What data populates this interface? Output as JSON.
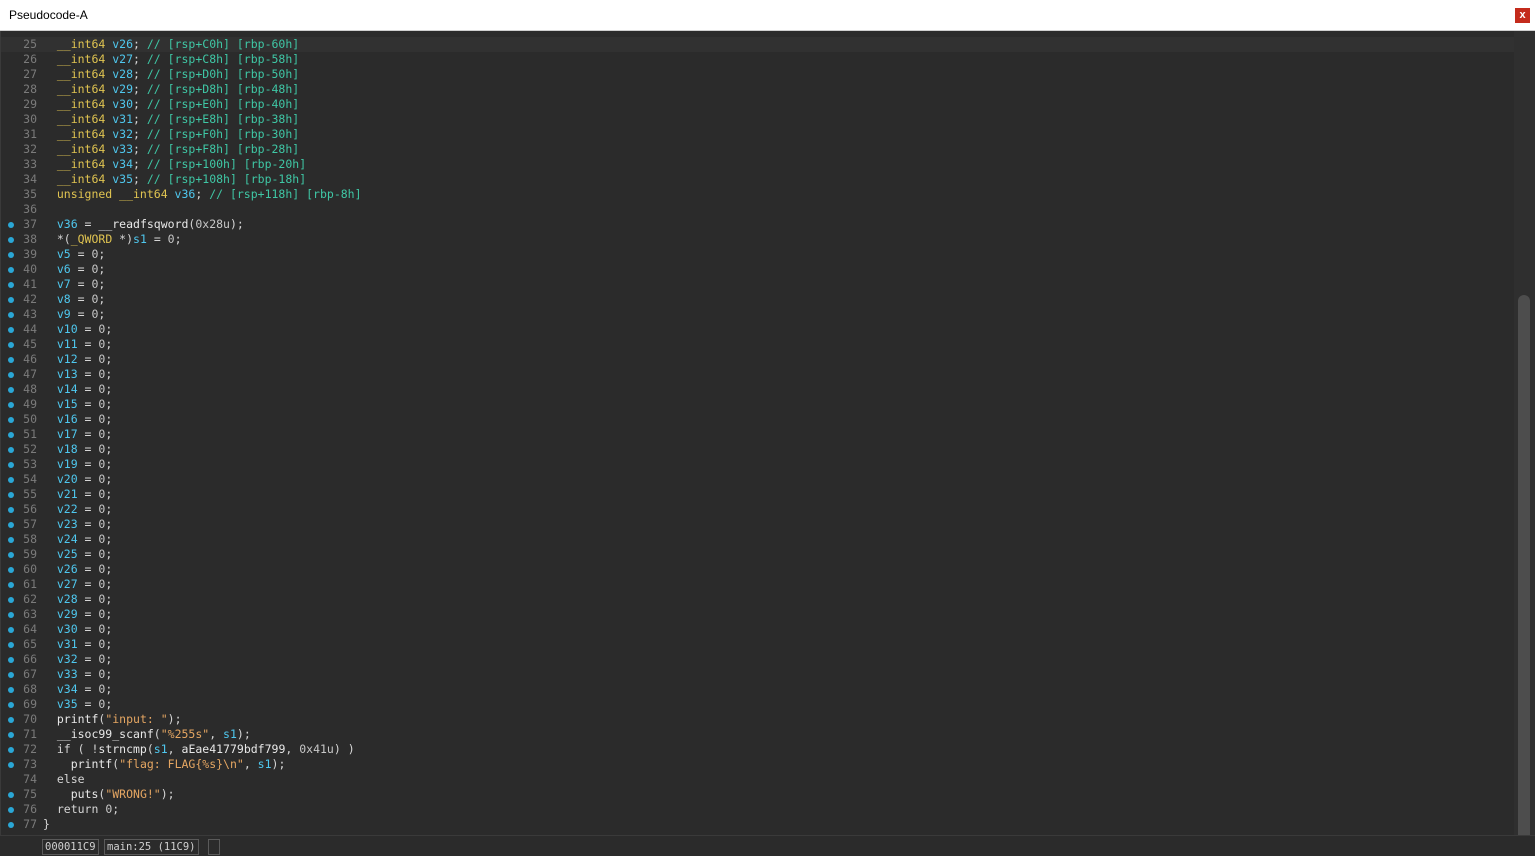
{
  "window": {
    "title": "Pseudocode-A",
    "close_label": "x"
  },
  "code_lines": [
    {
      "n": "25",
      "bp": false,
      "cur": true,
      "t": [
        [
          "kw",
          "  __int64"
        ],
        [
          "var",
          " v26"
        ],
        [
          "op",
          ";"
        ],
        [
          "cm",
          " // [rsp+C0h] [rbp-60h]"
        ]
      ]
    },
    {
      "n": "26",
      "bp": false,
      "t": [
        [
          "kw",
          "  __int64"
        ],
        [
          "var",
          " v27"
        ],
        [
          "op",
          ";"
        ],
        [
          "cm",
          " // [rsp+C8h] [rbp-58h]"
        ]
      ]
    },
    {
      "n": "27",
      "bp": false,
      "t": [
        [
          "kw",
          "  __int64"
        ],
        [
          "var",
          " v28"
        ],
        [
          "op",
          ";"
        ],
        [
          "cm",
          " // [rsp+D0h] [rbp-50h]"
        ]
      ]
    },
    {
      "n": "28",
      "bp": false,
      "t": [
        [
          "kw",
          "  __int64"
        ],
        [
          "var",
          " v29"
        ],
        [
          "op",
          ";"
        ],
        [
          "cm",
          " // [rsp+D8h] [rbp-48h]"
        ]
      ]
    },
    {
      "n": "29",
      "bp": false,
      "t": [
        [
          "kw",
          "  __int64"
        ],
        [
          "var",
          " v30"
        ],
        [
          "op",
          ";"
        ],
        [
          "cm",
          " // [rsp+E0h] [rbp-40h]"
        ]
      ]
    },
    {
      "n": "30",
      "bp": false,
      "t": [
        [
          "kw",
          "  __int64"
        ],
        [
          "var",
          " v31"
        ],
        [
          "op",
          ";"
        ],
        [
          "cm",
          " // [rsp+E8h] [rbp-38h]"
        ]
      ]
    },
    {
      "n": "31",
      "bp": false,
      "t": [
        [
          "kw",
          "  __int64"
        ],
        [
          "var",
          " v32"
        ],
        [
          "op",
          ";"
        ],
        [
          "cm",
          " // [rsp+F0h] [rbp-30h]"
        ]
      ]
    },
    {
      "n": "32",
      "bp": false,
      "t": [
        [
          "kw",
          "  __int64"
        ],
        [
          "var",
          " v33"
        ],
        [
          "op",
          ";"
        ],
        [
          "cm",
          " // [rsp+F8h] [rbp-28h]"
        ]
      ]
    },
    {
      "n": "33",
      "bp": false,
      "t": [
        [
          "kw",
          "  __int64"
        ],
        [
          "var",
          " v34"
        ],
        [
          "op",
          ";"
        ],
        [
          "cm",
          " // [rsp+100h] [rbp-20h]"
        ]
      ]
    },
    {
      "n": "34",
      "bp": false,
      "t": [
        [
          "kw",
          "  __int64"
        ],
        [
          "var",
          " v35"
        ],
        [
          "op",
          ";"
        ],
        [
          "cm",
          " // [rsp+108h] [rbp-18h]"
        ]
      ]
    },
    {
      "n": "35",
      "bp": false,
      "t": [
        [
          "kw",
          "  unsigned __int64"
        ],
        [
          "var",
          " v36"
        ],
        [
          "op",
          ";"
        ],
        [
          "cm",
          " // [rsp+118h] [rbp-8h]"
        ]
      ]
    },
    {
      "n": "36",
      "bp": false,
      "t": []
    },
    {
      "n": "37",
      "bp": true,
      "t": [
        [
          "var",
          "  v36"
        ],
        [
          "op",
          " = "
        ],
        [
          "fn",
          "__readfsqword"
        ],
        [
          "op",
          "("
        ],
        [
          "num",
          "0x28u"
        ],
        [
          "op",
          ");"
        ]
      ]
    },
    {
      "n": "38",
      "bp": true,
      "t": [
        [
          "op",
          "  *("
        ],
        [
          "kw",
          "_QWORD"
        ],
        [
          "op",
          " *)"
        ],
        [
          "var",
          "s1"
        ],
        [
          "op",
          " = "
        ],
        [
          "num",
          "0"
        ],
        [
          "op",
          ";"
        ]
      ]
    },
    {
      "n": "39",
      "bp": true,
      "t": [
        [
          "var",
          "  v5"
        ],
        [
          "op",
          " = "
        ],
        [
          "num",
          "0"
        ],
        [
          "op",
          ";"
        ]
      ]
    },
    {
      "n": "40",
      "bp": true,
      "t": [
        [
          "var",
          "  v6"
        ],
        [
          "op",
          " = "
        ],
        [
          "num",
          "0"
        ],
        [
          "op",
          ";"
        ]
      ]
    },
    {
      "n": "41",
      "bp": true,
      "t": [
        [
          "var",
          "  v7"
        ],
        [
          "op",
          " = "
        ],
        [
          "num",
          "0"
        ],
        [
          "op",
          ";"
        ]
      ]
    },
    {
      "n": "42",
      "bp": true,
      "t": [
        [
          "var",
          "  v8"
        ],
        [
          "op",
          " = "
        ],
        [
          "num",
          "0"
        ],
        [
          "op",
          ";"
        ]
      ]
    },
    {
      "n": "43",
      "bp": true,
      "t": [
        [
          "var",
          "  v9"
        ],
        [
          "op",
          " = "
        ],
        [
          "num",
          "0"
        ],
        [
          "op",
          ";"
        ]
      ]
    },
    {
      "n": "44",
      "bp": true,
      "t": [
        [
          "var",
          "  v10"
        ],
        [
          "op",
          " = "
        ],
        [
          "num",
          "0"
        ],
        [
          "op",
          ";"
        ]
      ]
    },
    {
      "n": "45",
      "bp": true,
      "t": [
        [
          "var",
          "  v11"
        ],
        [
          "op",
          " = "
        ],
        [
          "num",
          "0"
        ],
        [
          "op",
          ";"
        ]
      ]
    },
    {
      "n": "46",
      "bp": true,
      "t": [
        [
          "var",
          "  v12"
        ],
        [
          "op",
          " = "
        ],
        [
          "num",
          "0"
        ],
        [
          "op",
          ";"
        ]
      ]
    },
    {
      "n": "47",
      "bp": true,
      "t": [
        [
          "var",
          "  v13"
        ],
        [
          "op",
          " = "
        ],
        [
          "num",
          "0"
        ],
        [
          "op",
          ";"
        ]
      ]
    },
    {
      "n": "48",
      "bp": true,
      "t": [
        [
          "var",
          "  v14"
        ],
        [
          "op",
          " = "
        ],
        [
          "num",
          "0"
        ],
        [
          "op",
          ";"
        ]
      ]
    },
    {
      "n": "49",
      "bp": true,
      "t": [
        [
          "var",
          "  v15"
        ],
        [
          "op",
          " = "
        ],
        [
          "num",
          "0"
        ],
        [
          "op",
          ";"
        ]
      ]
    },
    {
      "n": "50",
      "bp": true,
      "t": [
        [
          "var",
          "  v16"
        ],
        [
          "op",
          " = "
        ],
        [
          "num",
          "0"
        ],
        [
          "op",
          ";"
        ]
      ]
    },
    {
      "n": "51",
      "bp": true,
      "t": [
        [
          "var",
          "  v17"
        ],
        [
          "op",
          " = "
        ],
        [
          "num",
          "0"
        ],
        [
          "op",
          ";"
        ]
      ]
    },
    {
      "n": "52",
      "bp": true,
      "t": [
        [
          "var",
          "  v18"
        ],
        [
          "op",
          " = "
        ],
        [
          "num",
          "0"
        ],
        [
          "op",
          ";"
        ]
      ]
    },
    {
      "n": "53",
      "bp": true,
      "t": [
        [
          "var",
          "  v19"
        ],
        [
          "op",
          " = "
        ],
        [
          "num",
          "0"
        ],
        [
          "op",
          ";"
        ]
      ]
    },
    {
      "n": "54",
      "bp": true,
      "t": [
        [
          "var",
          "  v20"
        ],
        [
          "op",
          " = "
        ],
        [
          "num",
          "0"
        ],
        [
          "op",
          ";"
        ]
      ]
    },
    {
      "n": "55",
      "bp": true,
      "t": [
        [
          "var",
          "  v21"
        ],
        [
          "op",
          " = "
        ],
        [
          "num",
          "0"
        ],
        [
          "op",
          ";"
        ]
      ]
    },
    {
      "n": "56",
      "bp": true,
      "t": [
        [
          "var",
          "  v22"
        ],
        [
          "op",
          " = "
        ],
        [
          "num",
          "0"
        ],
        [
          "op",
          ";"
        ]
      ]
    },
    {
      "n": "57",
      "bp": true,
      "t": [
        [
          "var",
          "  v23"
        ],
        [
          "op",
          " = "
        ],
        [
          "num",
          "0"
        ],
        [
          "op",
          ";"
        ]
      ]
    },
    {
      "n": "58",
      "bp": true,
      "t": [
        [
          "var",
          "  v24"
        ],
        [
          "op",
          " = "
        ],
        [
          "num",
          "0"
        ],
        [
          "op",
          ";"
        ]
      ]
    },
    {
      "n": "59",
      "bp": true,
      "t": [
        [
          "var",
          "  v25"
        ],
        [
          "op",
          " = "
        ],
        [
          "num",
          "0"
        ],
        [
          "op",
          ";"
        ]
      ]
    },
    {
      "n": "60",
      "bp": true,
      "t": [
        [
          "var",
          "  v26"
        ],
        [
          "op",
          " = "
        ],
        [
          "num",
          "0"
        ],
        [
          "op",
          ";"
        ]
      ]
    },
    {
      "n": "61",
      "bp": true,
      "t": [
        [
          "var",
          "  v27"
        ],
        [
          "op",
          " = "
        ],
        [
          "num",
          "0"
        ],
        [
          "op",
          ";"
        ]
      ]
    },
    {
      "n": "62",
      "bp": true,
      "t": [
        [
          "var",
          "  v28"
        ],
        [
          "op",
          " = "
        ],
        [
          "num",
          "0"
        ],
        [
          "op",
          ";"
        ]
      ]
    },
    {
      "n": "63",
      "bp": true,
      "t": [
        [
          "var",
          "  v29"
        ],
        [
          "op",
          " = "
        ],
        [
          "num",
          "0"
        ],
        [
          "op",
          ";"
        ]
      ]
    },
    {
      "n": "64",
      "bp": true,
      "t": [
        [
          "var",
          "  v30"
        ],
        [
          "op",
          " = "
        ],
        [
          "num",
          "0"
        ],
        [
          "op",
          ";"
        ]
      ]
    },
    {
      "n": "65",
      "bp": true,
      "t": [
        [
          "var",
          "  v31"
        ],
        [
          "op",
          " = "
        ],
        [
          "num",
          "0"
        ],
        [
          "op",
          ";"
        ]
      ]
    },
    {
      "n": "66",
      "bp": true,
      "t": [
        [
          "var",
          "  v32"
        ],
        [
          "op",
          " = "
        ],
        [
          "num",
          "0"
        ],
        [
          "op",
          ";"
        ]
      ]
    },
    {
      "n": "67",
      "bp": true,
      "t": [
        [
          "var",
          "  v33"
        ],
        [
          "op",
          " = "
        ],
        [
          "num",
          "0"
        ],
        [
          "op",
          ";"
        ]
      ]
    },
    {
      "n": "68",
      "bp": true,
      "t": [
        [
          "var",
          "  v34"
        ],
        [
          "op",
          " = "
        ],
        [
          "num",
          "0"
        ],
        [
          "op",
          ";"
        ]
      ]
    },
    {
      "n": "69",
      "bp": true,
      "t": [
        [
          "var",
          "  v35"
        ],
        [
          "op",
          " = "
        ],
        [
          "num",
          "0"
        ],
        [
          "op",
          ";"
        ]
      ]
    },
    {
      "n": "70",
      "bp": true,
      "t": [
        [
          "fn",
          "  printf"
        ],
        [
          "op",
          "("
        ],
        [
          "str",
          "\"input: \""
        ],
        [
          "op",
          ");"
        ]
      ]
    },
    {
      "n": "71",
      "bp": true,
      "t": [
        [
          "fn",
          "  __isoc99_scanf"
        ],
        [
          "op",
          "("
        ],
        [
          "str",
          "\"%255s\""
        ],
        [
          "op",
          ", "
        ],
        [
          "var",
          "s1"
        ],
        [
          "op",
          ");"
        ]
      ]
    },
    {
      "n": "72",
      "bp": true,
      "t": [
        [
          "op",
          "  if ( !"
        ],
        [
          "fn",
          "strncmp"
        ],
        [
          "op",
          "("
        ],
        [
          "var",
          "s1"
        ],
        [
          "op",
          ", "
        ],
        [
          "fn",
          "aEae41779bdf799"
        ],
        [
          "op",
          ", "
        ],
        [
          "num",
          "0x41u"
        ],
        [
          "op",
          ") )"
        ]
      ]
    },
    {
      "n": "73",
      "bp": true,
      "t": [
        [
          "fn",
          "    printf"
        ],
        [
          "op",
          "("
        ],
        [
          "str",
          "\"flag: FLAG{%s}\\n\""
        ],
        [
          "op",
          ", "
        ],
        [
          "var",
          "s1"
        ],
        [
          "op",
          ");"
        ]
      ]
    },
    {
      "n": "74",
      "bp": false,
      "t": [
        [
          "op",
          "  else"
        ]
      ]
    },
    {
      "n": "75",
      "bp": true,
      "t": [
        [
          "fn",
          "    puts"
        ],
        [
          "op",
          "("
        ],
        [
          "str",
          "\"WRONG!\""
        ],
        [
          "op",
          ");"
        ]
      ]
    },
    {
      "n": "76",
      "bp": true,
      "t": [
        [
          "op",
          "  return "
        ],
        [
          "num",
          "0"
        ],
        [
          "op",
          ";"
        ]
      ]
    },
    {
      "n": "77",
      "bp": true,
      "t": [
        [
          "op",
          "}"
        ]
      ]
    }
  ],
  "status": {
    "address": "000011C9",
    "location": "main:25 (11C9)",
    "extra": ""
  },
  "colors": {
    "background": "#2b2b2b",
    "keyword": "#e0c451",
    "variable": "#4fc8ef",
    "comment": "#3fc7a5",
    "string": "#e5a662",
    "breakpoint": "#2aa7d6"
  }
}
